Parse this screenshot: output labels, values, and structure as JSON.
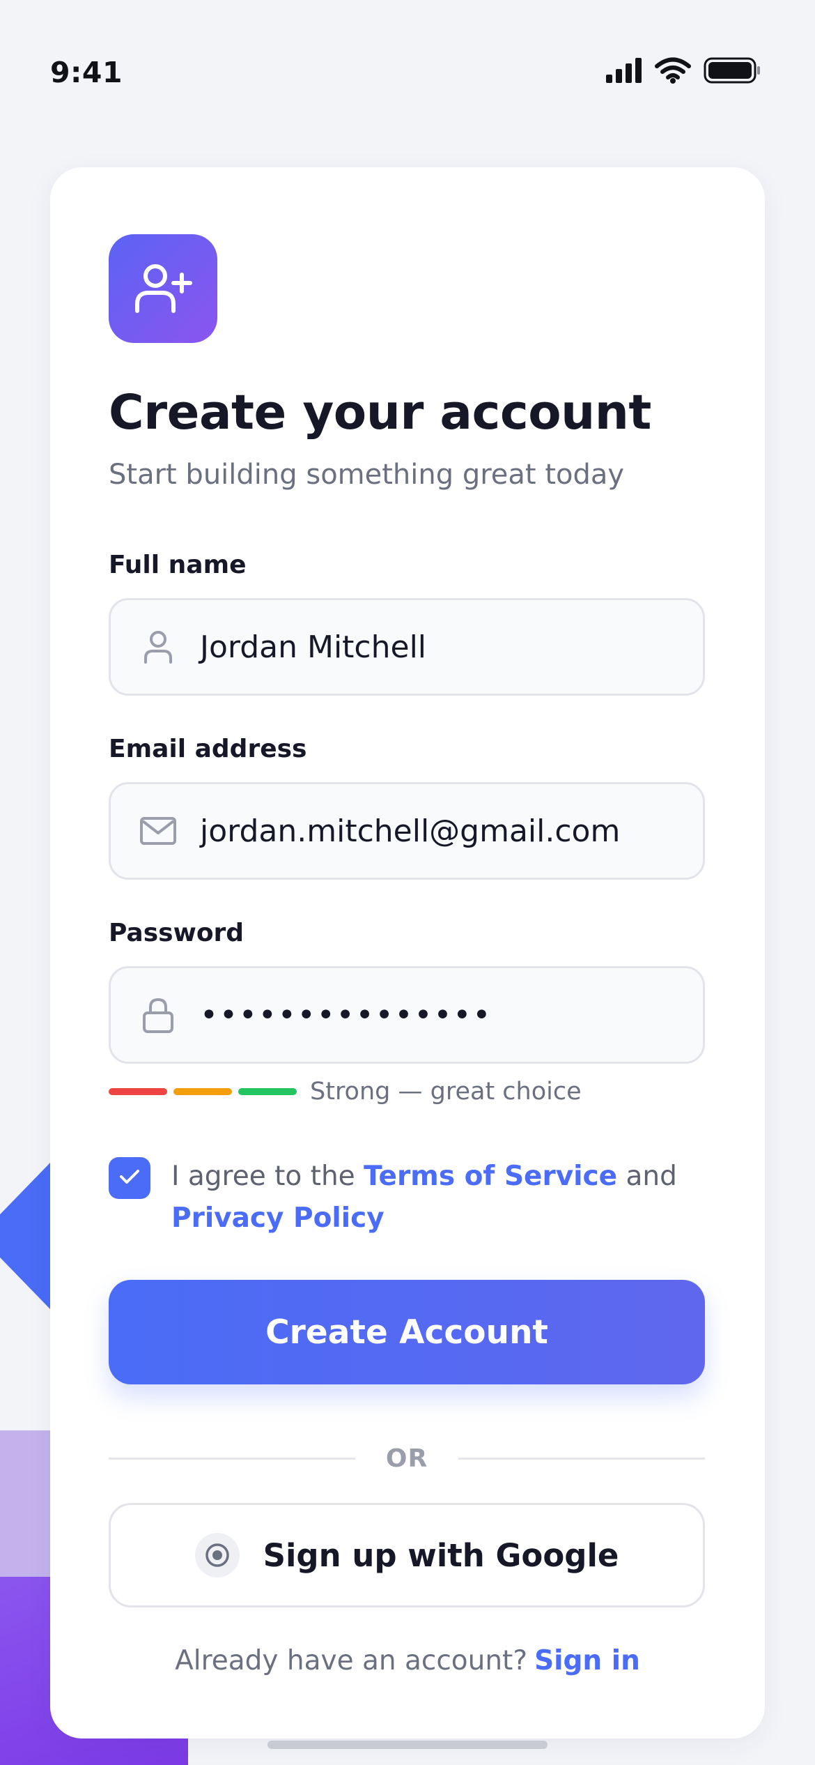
{
  "status_bar": {
    "time": "9:41",
    "icons": [
      "cellular-signal-icon",
      "wifi-icon",
      "battery-icon"
    ]
  },
  "header": {
    "app_icon": "user-plus-icon",
    "title": "Create your account",
    "subtitle": "Start building something great today"
  },
  "form": {
    "full_name": {
      "label": "Full name",
      "value": "Jordan Mitchell",
      "icon": "person-icon"
    },
    "email": {
      "label": "Email address",
      "value": "jordan.mitchell@gmail.com",
      "icon": "mail-icon"
    },
    "password": {
      "label": "Password",
      "value": "•••••••••••••••",
      "icon": "lock-icon"
    },
    "strength": {
      "text": "Strong — great choice",
      "segment_colors": [
        "#ef4444",
        "#f59e0b",
        "#22c55e"
      ]
    },
    "agree": {
      "checked": true,
      "prefix": "I agree to the ",
      "terms_link": "Terms of Service",
      "middle": " and ",
      "privacy_link": "Privacy Policy"
    }
  },
  "actions": {
    "primary_label": "Create Account",
    "divider_label": "OR",
    "google_label": "Sign up with Google",
    "google_icon": "radio-dot-icon"
  },
  "footer": {
    "prompt": "Already have an account?",
    "link": "Sign in"
  },
  "colors": {
    "accent": "#4a6cf6",
    "icon_gradient_start": "#5b63f4",
    "icon_gradient_end": "#8b55ef",
    "background": "#f3f4f8"
  }
}
